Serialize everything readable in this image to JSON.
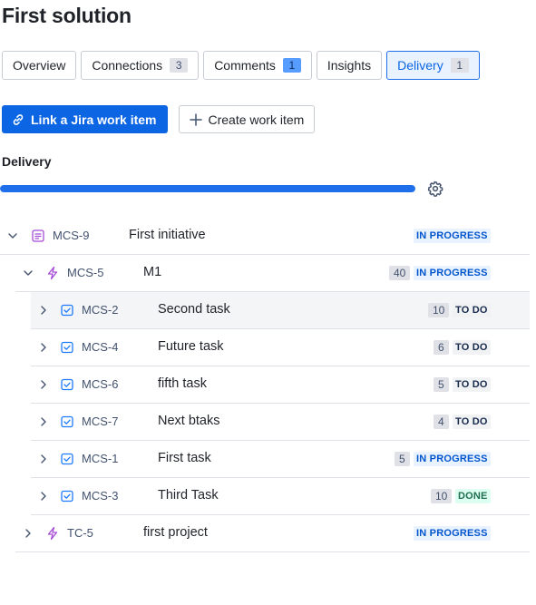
{
  "page": {
    "title": "First solution"
  },
  "tabs": [
    {
      "label": "Overview",
      "count": null
    },
    {
      "label": "Connections",
      "count": "3"
    },
    {
      "label": "Comments",
      "count": "1"
    },
    {
      "label": "Insights",
      "count": null
    },
    {
      "label": "Delivery",
      "count": "1"
    }
  ],
  "actions": {
    "link_label": "Link a Jira work item",
    "create_label": "Create work item"
  },
  "delivery": {
    "label": "Delivery",
    "progress_fraction": 1.0
  },
  "rows": [
    {
      "key": "MCS-9",
      "summary": "First initiative",
      "estimate": "",
      "status": "IN PROGRESS",
      "type": "initiative",
      "expanded": true
    },
    {
      "key": "MCS-5",
      "summary": "M1",
      "estimate": "40",
      "status": "IN PROGRESS",
      "type": "epic",
      "expanded": true
    },
    {
      "key": "MCS-2",
      "summary": "Second task",
      "estimate": "10",
      "status": "TO DO",
      "type": "task",
      "expanded": false
    },
    {
      "key": "MCS-4",
      "summary": "Future task",
      "estimate": "6",
      "status": "TO DO",
      "type": "task",
      "expanded": false
    },
    {
      "key": "MCS-6",
      "summary": "fifth task",
      "estimate": "5",
      "status": "TO DO",
      "type": "task",
      "expanded": false
    },
    {
      "key": "MCS-7",
      "summary": "Next btaks",
      "estimate": "4",
      "status": "TO DO",
      "type": "task",
      "expanded": false
    },
    {
      "key": "MCS-1",
      "summary": "First task",
      "estimate": "5",
      "status": "IN PROGRESS",
      "type": "task",
      "expanded": false
    },
    {
      "key": "MCS-3",
      "summary": "Third Task",
      "estimate": "10",
      "status": "DONE",
      "type": "task",
      "expanded": false
    },
    {
      "key": "TC-5",
      "summary": "first project",
      "estimate": "",
      "status": "IN PROGRESS",
      "type": "epic",
      "expanded": false
    }
  ]
}
